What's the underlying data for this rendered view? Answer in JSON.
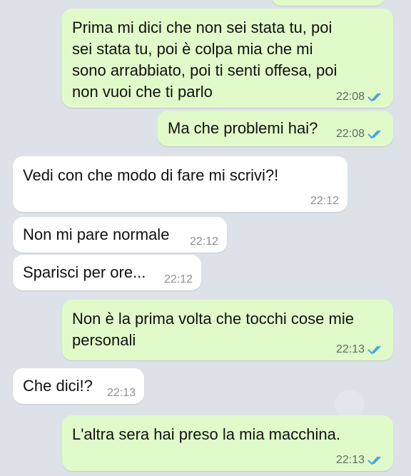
{
  "messages": [
    {
      "dir": "out",
      "text": "Prima mi dici che non sei stata tu, poi sei stata tu, poi è colpa mia che mi sono arrabbiato, poi ti senti offesa, poi non vuoi che ti parlo",
      "time": "22:08",
      "read": true
    },
    {
      "dir": "out",
      "text": "Ma che problemi hai?",
      "time": "22:08",
      "read": true
    },
    {
      "dir": "in",
      "text": "Vedi con che modo di fare mi scrivi?!",
      "time": "22:12"
    },
    {
      "dir": "in",
      "text": "Non mi pare normale",
      "time": "22:12"
    },
    {
      "dir": "in",
      "text": "Sparisci per ore...",
      "time": "22:12"
    },
    {
      "dir": "out",
      "text": "Non è la prima volta che tocchi cose mie personali",
      "time": "22:13",
      "read": true
    },
    {
      "dir": "in",
      "text": "Che dici!?",
      "time": "22:13"
    },
    {
      "dir": "out",
      "text": "L'altra sera hai preso la mia macchina.",
      "time": "22:13",
      "read": true
    }
  ],
  "colors": {
    "outgoing_bubble": "#e0fbc9",
    "incoming_bubble": "#ffffff",
    "read_ticks": "#4aa3df"
  },
  "icons": {
    "read_status": "double-check-icon"
  }
}
